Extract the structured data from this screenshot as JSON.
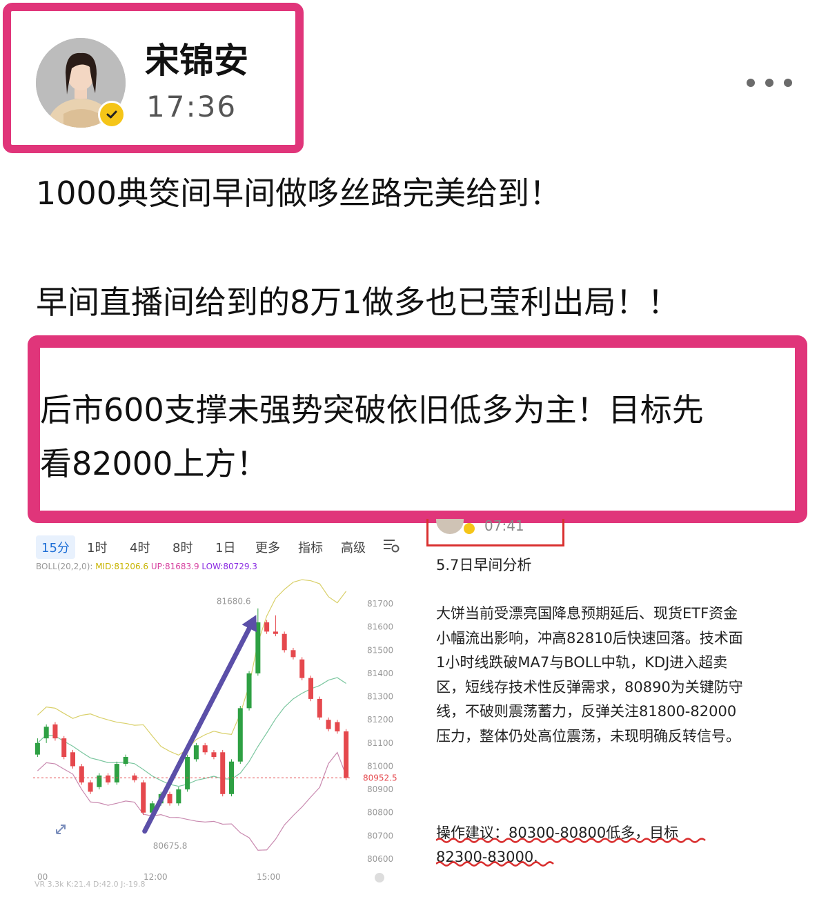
{
  "header": {
    "author_name": "宋锦安",
    "post_time": "17:36",
    "more_icon": "more-dots-icon",
    "verified_icon": "verified-check-icon",
    "accent_color": "#e0357a",
    "verified_color": "#f5c518"
  },
  "post": {
    "line1": "1000典筊间早间做哆丝路完美给到！",
    "line2": "早间直播间给到的8万1做多也已莹利出局！！",
    "highlight_line1": "后市600支撑未强势突破依旧低多为主！目标先",
    "highlight_line2": "看82000上方！"
  },
  "chart_card": {
    "tabs": [
      "15分",
      "1时",
      "4时",
      "8时",
      "1日",
      "更多",
      "指标",
      "高级"
    ],
    "active_tab": "15分",
    "boll_prefix": "BOLL(20,2,0):",
    "boll_mid": "MID:81206.6",
    "boll_up": "UP:81683.9",
    "boll_low": "LOW:80729.3",
    "high_label": "81680.6",
    "low_label": "80675.8",
    "current_price": "80952.5",
    "y_ticks": [
      "81700",
      "81600",
      "81500",
      "81400",
      "81300",
      "81200",
      "81100",
      "81000",
      "80900",
      "80800",
      "80700",
      "80600"
    ],
    "x_ticks": [
      "00",
      "12:00",
      "15:00"
    ],
    "bottom_partial": "VR 3.3k K:21.4 D:42.0 J:-19.8",
    "colors": {
      "up": "#2ea043",
      "down": "#e5484d",
      "arrow": "#5b4fa8",
      "boll_mid": "#7cc7a0",
      "boll_up": "#d9d06a",
      "boll_low": "#c98ab0"
    }
  },
  "chart_data": {
    "type": "candlestick",
    "series_note": "BTC 15m candles",
    "ylim": [
      80600,
      81700
    ],
    "candles": [
      {
        "o": 81050,
        "c": 81100,
        "h": 81120,
        "l": 81040
      },
      {
        "o": 81120,
        "c": 81170,
        "h": 81180,
        "l": 81100
      },
      {
        "o": 81180,
        "c": 81120,
        "h": 81190,
        "l": 81110
      },
      {
        "o": 81120,
        "c": 81040,
        "h": 81130,
        "l": 81030
      },
      {
        "o": 81060,
        "c": 81000,
        "h": 81070,
        "l": 80990
      },
      {
        "o": 81000,
        "c": 80930,
        "h": 81010,
        "l": 80920
      },
      {
        "o": 80930,
        "c": 80890,
        "h": 80940,
        "l": 80880
      },
      {
        "o": 80910,
        "c": 80960,
        "h": 80970,
        "l": 80900
      },
      {
        "o": 80960,
        "c": 80930,
        "h": 80970,
        "l": 80920
      },
      {
        "o": 80930,
        "c": 81010,
        "h": 81020,
        "l": 80920
      },
      {
        "o": 81010,
        "c": 81040,
        "h": 81050,
        "l": 81000
      },
      {
        "o": 80960,
        "c": 80940,
        "h": 80970,
        "l": 80930
      },
      {
        "o": 80930,
        "c": 80800,
        "h": 80940,
        "l": 80790
      },
      {
        "o": 80800,
        "c": 80840,
        "h": 80850,
        "l": 80790
      },
      {
        "o": 80840,
        "c": 80880,
        "h": 80890,
        "l": 80830
      },
      {
        "o": 80880,
        "c": 80840,
        "h": 80890,
        "l": 80830
      },
      {
        "o": 80840,
        "c": 80900,
        "h": 80910,
        "l": 80830
      },
      {
        "o": 80900,
        "c": 81040,
        "h": 81050,
        "l": 80890
      },
      {
        "o": 81030,
        "c": 81090,
        "h": 81100,
        "l": 81020
      },
      {
        "o": 81090,
        "c": 81060,
        "h": 81100,
        "l": 81050
      },
      {
        "o": 81060,
        "c": 81040,
        "h": 81070,
        "l": 81030
      },
      {
        "o": 81060,
        "c": 80880,
        "h": 81070,
        "l": 80870
      },
      {
        "o": 80880,
        "c": 81020,
        "h": 81030,
        "l": 80870
      },
      {
        "o": 81020,
        "c": 81250,
        "h": 81260,
        "l": 81010
      },
      {
        "o": 81250,
        "c": 81400,
        "h": 81410,
        "l": 81240
      },
      {
        "o": 81400,
        "c": 81620,
        "h": 81680,
        "l": 81390
      },
      {
        "o": 81620,
        "c": 81580,
        "h": 81630,
        "l": 81570
      },
      {
        "o": 81580,
        "c": 81570,
        "h": 81650,
        "l": 81560
      },
      {
        "o": 81570,
        "c": 81500,
        "h": 81580,
        "l": 81490
      },
      {
        "o": 81500,
        "c": 81470,
        "h": 81510,
        "l": 81460
      },
      {
        "o": 81460,
        "c": 81380,
        "h": 81470,
        "l": 81370
      },
      {
        "o": 81380,
        "c": 81290,
        "h": 81390,
        "l": 81280
      },
      {
        "o": 81290,
        "c": 81210,
        "h": 81300,
        "l": 81200
      },
      {
        "o": 81200,
        "c": 81160,
        "h": 81210,
        "l": 81150
      },
      {
        "o": 81190,
        "c": 81150,
        "h": 81200,
        "l": 81140
      },
      {
        "o": 81150,
        "c": 80950,
        "h": 81160,
        "l": 80940
      }
    ]
  },
  "analysis": {
    "snip_time": "07:41",
    "title": "5.7日早间分析",
    "body": "大饼当前受漂亮国降息预期延后、现货ETF资金\n小幅流出影响，冲高82810后快速回落。技术面\n1小时线跌破MA7与BOLL中轨，KDJ进入超卖\n区，短线存技术性反弹需求，80890为关键防守\n线，不破则震荡蓄力，反弹关注81800-82000\n压力，整体仍处高位震荡，未现明确反转信号。",
    "advice": "操作建议：80300-80800低多，目标\n82300-83000."
  }
}
